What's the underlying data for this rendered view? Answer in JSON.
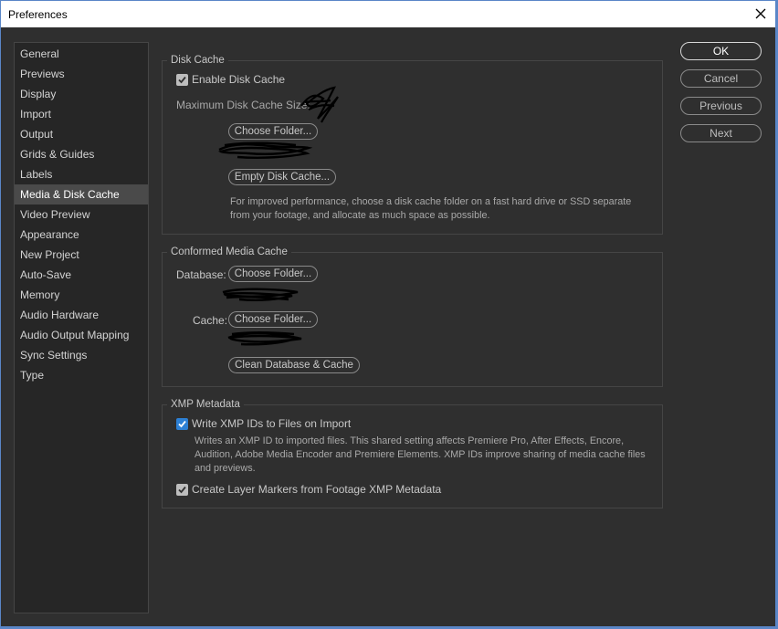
{
  "window": {
    "title": "Preferences"
  },
  "sidebar": {
    "items": [
      {
        "label": "General"
      },
      {
        "label": "Previews"
      },
      {
        "label": "Display"
      },
      {
        "label": "Import"
      },
      {
        "label": "Output"
      },
      {
        "label": "Grids & Guides"
      },
      {
        "label": "Labels"
      },
      {
        "label": "Media & Disk Cache",
        "selected": true
      },
      {
        "label": "Video Preview"
      },
      {
        "label": "Appearance"
      },
      {
        "label": "New Project"
      },
      {
        "label": "Auto-Save"
      },
      {
        "label": "Memory"
      },
      {
        "label": "Audio Hardware"
      },
      {
        "label": "Audio Output Mapping"
      },
      {
        "label": "Sync Settings"
      },
      {
        "label": "Type"
      }
    ]
  },
  "disk_cache": {
    "title": "Disk Cache",
    "enable_label": "Enable Disk Cache",
    "enable_checked": true,
    "max_size_label": "Maximum Disk Cache Size:",
    "choose_folder": "Choose Folder...",
    "empty_button": "Empty Disk Cache...",
    "description": "For improved performance, choose a disk cache folder on a fast hard drive or SSD separate from your footage, and allocate as much space as possible."
  },
  "conformed": {
    "title": "Conformed Media Cache",
    "database_label": "Database:",
    "database_button": "Choose Folder...",
    "cache_label": "Cache:",
    "cache_button": "Choose Folder...",
    "clean_button": "Clean Database & Cache"
  },
  "xmp": {
    "title": "XMP Metadata",
    "write_label": "Write XMP IDs to Files on Import",
    "write_checked": true,
    "write_description": "Writes an XMP ID to imported files. This shared setting affects Premiere Pro, After Effects, Encore, Audition, Adobe Media Encoder and Premiere Elements. XMP IDs improve sharing of media cache files and previews.",
    "markers_label": "Create Layer Markers from Footage XMP Metadata",
    "markers_checked": true
  },
  "buttons": {
    "ok": "OK",
    "cancel": "Cancel",
    "previous": "Previous",
    "next": "Next"
  },
  "colors": {
    "background": "#2f2f2f",
    "sidebar_bg": "#262626",
    "selected_item": "#4a4a4a",
    "checkbox_blue": "#2d80d4",
    "window_border": "#5a86c7"
  }
}
